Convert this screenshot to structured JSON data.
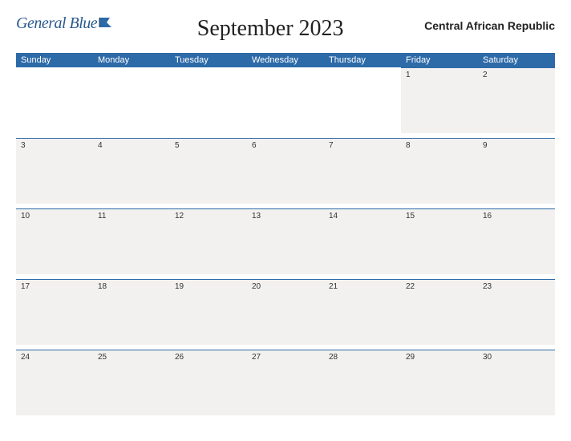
{
  "logo": {
    "text": "General Blue"
  },
  "title": "September 2023",
  "region": "Central African Republic",
  "dayHeaders": [
    "Sunday",
    "Monday",
    "Tuesday",
    "Wednesday",
    "Thursday",
    "Friday",
    "Saturday"
  ],
  "weeks": [
    [
      "",
      "",
      "",
      "",
      "",
      "1",
      "2"
    ],
    [
      "3",
      "4",
      "5",
      "6",
      "7",
      "8",
      "9"
    ],
    [
      "10",
      "11",
      "12",
      "13",
      "14",
      "15",
      "16"
    ],
    [
      "17",
      "18",
      "19",
      "20",
      "21",
      "22",
      "23"
    ],
    [
      "24",
      "25",
      "26",
      "27",
      "28",
      "29",
      "30"
    ]
  ]
}
